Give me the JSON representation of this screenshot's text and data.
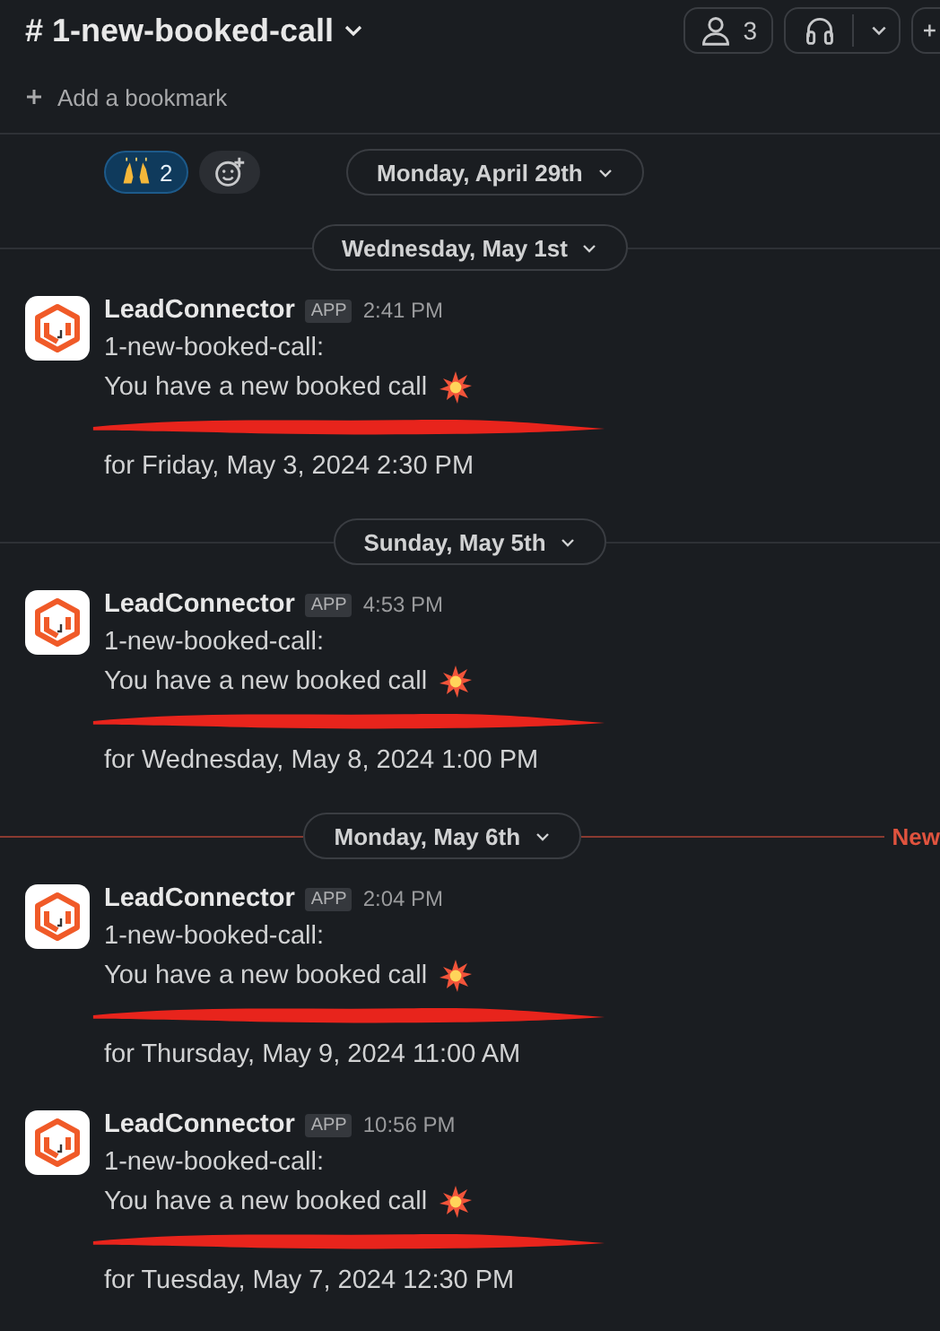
{
  "channel": {
    "prefix": "#",
    "name": "1-new-booked-call"
  },
  "header": {
    "member_count": "3"
  },
  "bookmark_bar": {
    "label": "Add a bookmark"
  },
  "reactions": [
    {
      "count": "2",
      "selected": true
    }
  ],
  "top_date": "Monday, April 29th",
  "timeline": [
    {
      "kind": "date",
      "label": "Wednesday, May 1st"
    },
    {
      "kind": "message",
      "sender": "LeadConnector",
      "badge": "APP",
      "time": "2:41 PM",
      "lines": [
        "1-new-booked-call:",
        "You have a new booked call"
      ],
      "redacted": true,
      "when": "for Friday, May 3, 2024 2:30 PM"
    },
    {
      "kind": "date",
      "label": "Sunday, May 5th"
    },
    {
      "kind": "message",
      "sender": "LeadConnector",
      "badge": "APP",
      "time": "4:53 PM",
      "lines": [
        "1-new-booked-call:",
        "You have a new booked call"
      ],
      "redacted": true,
      "when": "for Wednesday, May 8, 2024 1:00 PM"
    },
    {
      "kind": "date",
      "label": "Monday, May 6th",
      "new_label": "New"
    },
    {
      "kind": "message",
      "sender": "LeadConnector",
      "badge": "APP",
      "time": "2:04 PM",
      "lines": [
        "1-new-booked-call:",
        "You have a new booked call"
      ],
      "redacted": true,
      "when": "for Thursday, May 9, 2024 11:00 AM"
    },
    {
      "kind": "message",
      "sender": "LeadConnector",
      "badge": "APP",
      "time": "10:56 PM",
      "lines": [
        "1-new-booked-call:",
        "You have a new booked call"
      ],
      "redacted": true,
      "when": "for Tuesday, May 7, 2024 12:30 PM"
    }
  ]
}
